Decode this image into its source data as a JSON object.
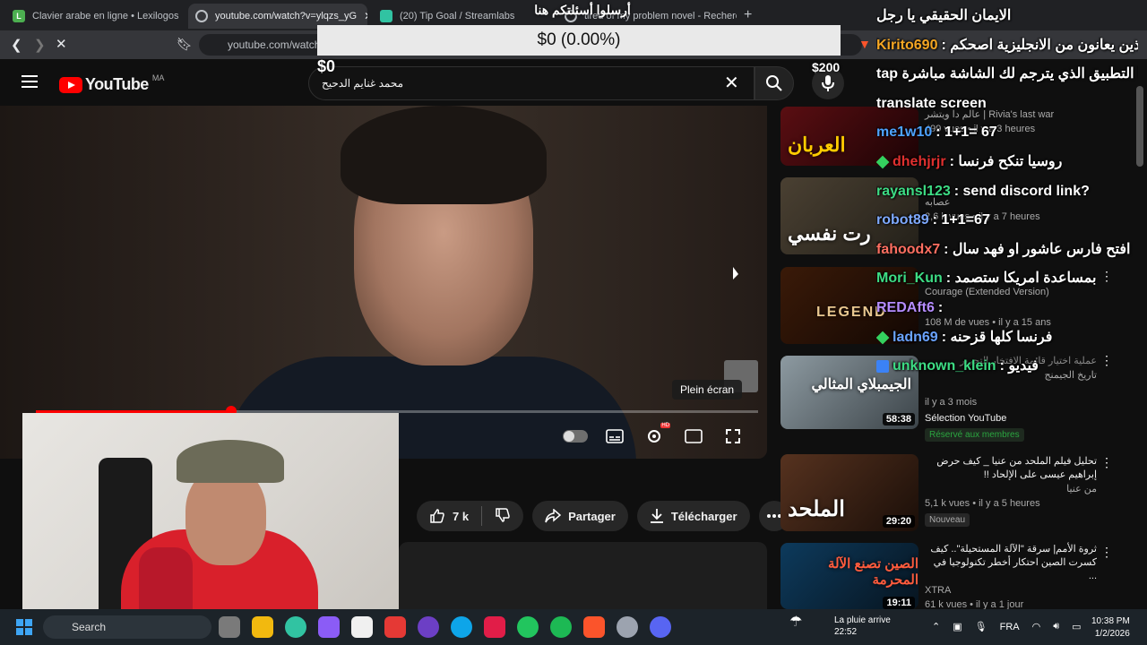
{
  "browser": {
    "tabs": [
      {
        "title": "Clavier arabe en ligne • Lexilogos"
      },
      {
        "title": "youtube.com/watch?v=ylqzs_yG"
      },
      {
        "title": "(20) Tip Goal / Streamlabs"
      },
      {
        "title": "tired of my problem novel - Recherch"
      }
    ],
    "url": "youtube.com/watch"
  },
  "tip_goal": {
    "title": "أرسلوا أسئلتكم هنا",
    "progress": "$0 (0.00%)",
    "min": "$0",
    "max": "$200",
    "fraction": 0
  },
  "youtube": {
    "logo": "YouTube",
    "country": "MA",
    "search_query": "محمد غنايم الدحيح"
  },
  "player": {
    "fullscreen_tooltip": "Plein écran",
    "progress_fraction": 0.27
  },
  "actions": {
    "likes": "7 k",
    "share": "Partager",
    "download": "Télécharger"
  },
  "recommendations": [
    {
      "thumb_text": "العربان",
      "title": "",
      "channel": "عالم دا ويتشر | Rivia's last war",
      "meta": "499 vues • il y a 3 heures",
      "duration": "",
      "tag": ""
    },
    {
      "thumb_text": "رت نفسي",
      "title": "",
      "channel": "عصابه",
      "meta": "2,6 k vues • il y a 7 heures",
      "duration": "",
      "tag": ""
    },
    {
      "thumb_text": "LEGEND",
      "title": "Courage (Extended Version)",
      "channel": "",
      "meta": "108 M de vues • il y a 15 ans",
      "duration": "",
      "tag": ""
    },
    {
      "thumb_text": "الجيمبلاي المثالي",
      "title": "عملية اختيار قائمة الافتخار التحرير",
      "channel": "تاريخ الجيمنج",
      "meta": "il y a 3 mois",
      "duration": "58:38",
      "tag": "Sélection YouTube",
      "tag2": "Réservé aux membres"
    },
    {
      "thumb_text": "الملحد",
      "title": "تحليل فيلم الملحد من عنيا _ كيف حرض إبراهيم عيسى على الإلحاد !!",
      "channel": "من عنيا",
      "meta": "5,1 k vues • il y a 5 heures",
      "duration": "29:20",
      "tag": "Nouveau"
    },
    {
      "thumb_text": "الصين تصنع الآلة المحرمة",
      "title": "ثروة الأمم| سرقة \"الآلة المستحيلة\".. كيف كسرت الصين احتكار أخطر تكنولوجيا في ...",
      "channel": "XTRA",
      "meta": "61 k vues • il y a 1 jour",
      "duration": "19:11",
      "tag": ""
    }
  ],
  "chat": [
    {
      "user": "",
      "message": "الايمان الحقيقي يا رجل",
      "color": "#ffffff",
      "badge": ""
    },
    {
      "user": "Kirito690",
      "message": "الذين يعانون من الانجليزية اصحكم",
      "color": "#f5a623",
      "badge": ""
    },
    {
      "user": "",
      "message": "tap بهذا التطبيق الذي يترجم لك الشاشة مباشرة",
      "color": "#ffffff",
      "badge": ""
    },
    {
      "user": "",
      "message": "translate screen",
      "color": "#ffffff",
      "badge": ""
    },
    {
      "user": "me1w10",
      "message": "1+1= 67",
      "color": "#4ea3ff",
      "badge": ""
    },
    {
      "user": "dhehjrjr",
      "message": "روسيا تنكح فرنسا",
      "color": "#e0302f",
      "badge": "diamond"
    },
    {
      "user": "rayansl123",
      "message": "send discord link?",
      "color": "#3ddc84",
      "badge": ""
    },
    {
      "user": "robot89",
      "message": "1+1=67",
      "color": "#7ea9ff",
      "badge": ""
    },
    {
      "user": "fahoodx7",
      "message": "افتح فارس عاشور او فهد سال",
      "color": "#ff6f61",
      "badge": ""
    },
    {
      "user": "Mori_Kun",
      "message": "بمساعدة امريكا ستصمد",
      "color": "#3ddc84",
      "badge": ""
    },
    {
      "user": "REDAft6",
      "message": "",
      "color": "#b58cff",
      "badge": ""
    },
    {
      "user": "ladn69",
      "message": "فرنسا كلها قزحنه",
      "color": "#6aa3ff",
      "badge": "diamond"
    },
    {
      "user": "unknown_klein",
      "message": "فيديو",
      "color": "#3ddc84",
      "badge": "prime"
    }
  ],
  "taskbar": {
    "search": "Search",
    "weather_title": "La pluie arrive",
    "weather_sub": "22:52",
    "lang": "FRA",
    "time": "10:38 PM",
    "date": "1/2/2026"
  }
}
